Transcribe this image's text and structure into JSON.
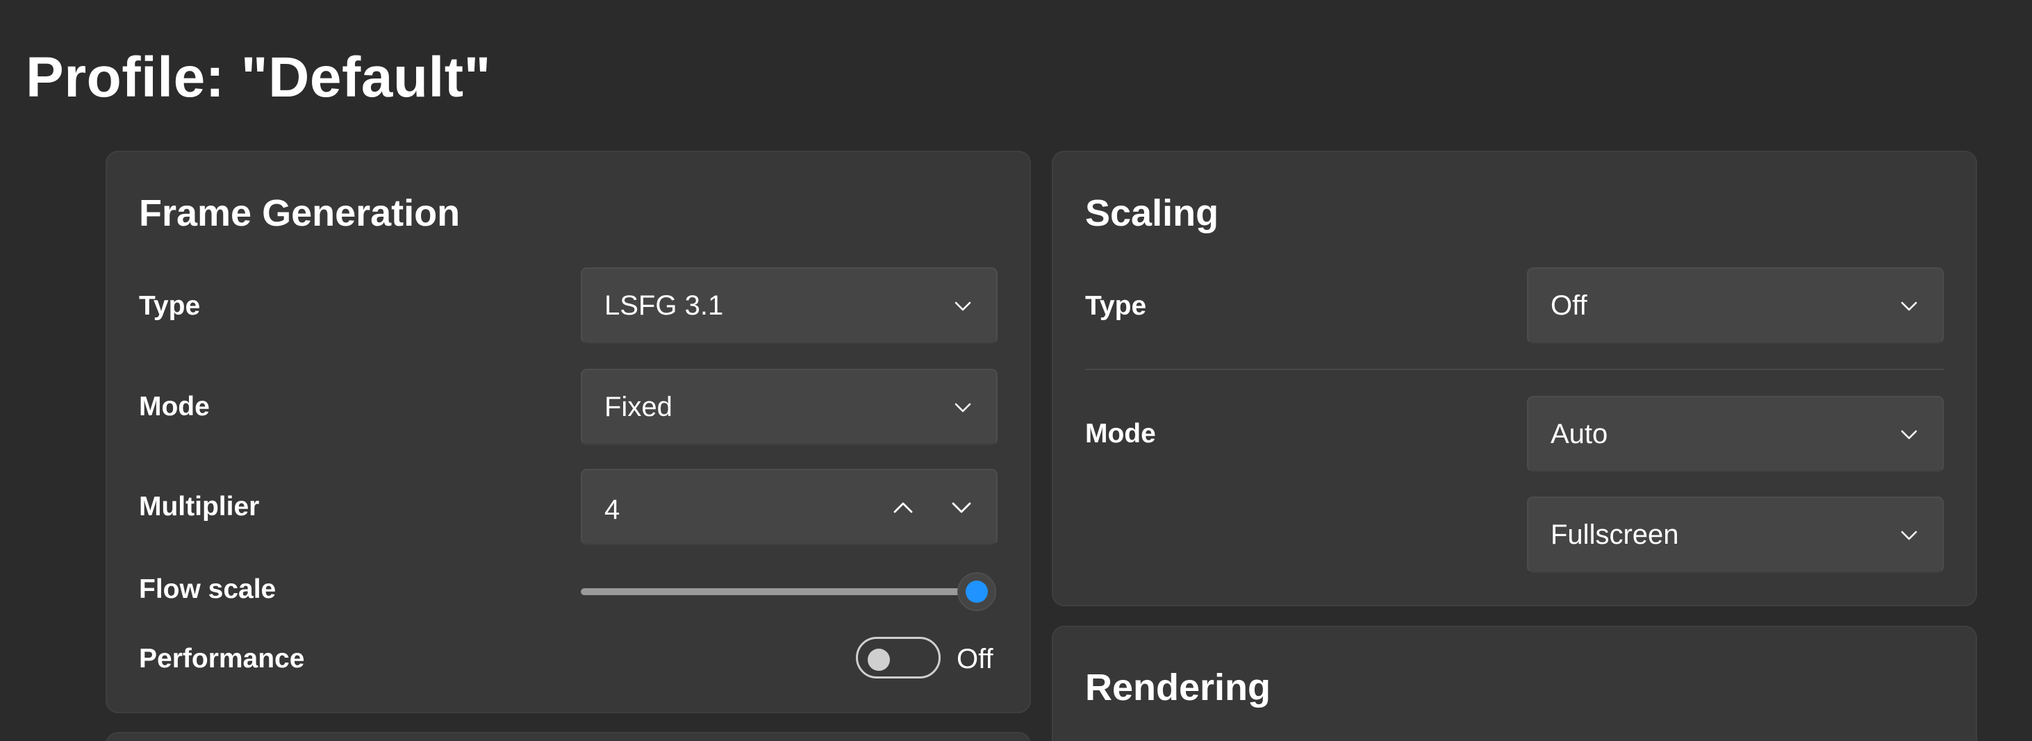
{
  "page": {
    "title": "Profile: \"Default\""
  },
  "frame_generation": {
    "title": "Frame Generation",
    "type_label": "Type",
    "type_value": "LSFG 3.1",
    "mode_label": "Mode",
    "mode_value": "Fixed",
    "multiplier_label": "Multiplier",
    "multiplier_value": "4",
    "flow_scale_label": "Flow scale",
    "flow_scale_value": 1.0,
    "performance_label": "Performance",
    "performance_state": "Off"
  },
  "scaling": {
    "title": "Scaling",
    "type_label": "Type",
    "type_value": "Off",
    "mode_label": "Mode",
    "mode_value": "Auto",
    "fit_value": "Fullscreen"
  },
  "rendering": {
    "title": "Rendering"
  },
  "icons": {
    "dropdown": "chevron-down-icon",
    "stepper_up": "chevron-up-icon",
    "stepper_down": "chevron-down-icon"
  },
  "colors": {
    "background": "#2b2b2b",
    "card": "#383838",
    "control": "#454545",
    "accent": "#1f93ff"
  }
}
